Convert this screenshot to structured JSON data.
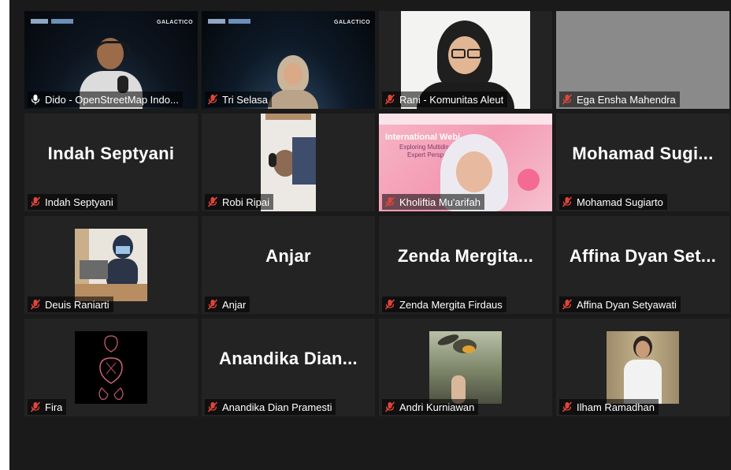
{
  "participants": [
    {
      "label": "Dido - OpenStreetMap Indo...",
      "display_name": "",
      "muted": false,
      "speaking": true
    },
    {
      "label": "Tri Selasa",
      "display_name": "",
      "muted": true
    },
    {
      "label": "Rani - Komunitas Aleut",
      "display_name": "",
      "muted": true
    },
    {
      "label": "Ega Ensha Mahendra",
      "display_name": "",
      "muted": true
    },
    {
      "label": "Indah Septyani",
      "display_name": "Indah Septyani",
      "muted": true
    },
    {
      "label": "Robi Ripai",
      "display_name": "",
      "muted": true
    },
    {
      "label": "Kholiftia Mu'arifah",
      "display_name": "",
      "muted": true
    },
    {
      "label": "Mohamad Sugiarto",
      "display_name": "Mohamad Sugi...",
      "muted": true
    },
    {
      "label": "Deuis Raniarti",
      "display_name": "",
      "muted": true
    },
    {
      "label": "Anjar",
      "display_name": "Anjar",
      "muted": true
    },
    {
      "label": "Zenda Mergita Firdaus",
      "display_name": "Zenda Mergita...",
      "muted": true
    },
    {
      "label": "Affina Dyan Setyawati",
      "display_name": "Affina Dyan Set...",
      "muted": true
    },
    {
      "label": "Fira",
      "display_name": "",
      "muted": true
    },
    {
      "label": "Anandika Dian Pramesti",
      "display_name": "Anandika Dian...",
      "muted": true
    },
    {
      "label": "Andri Kurniawan",
      "display_name": "",
      "muted": true
    },
    {
      "label": "Ilham Ramadhan",
      "display_name": "",
      "muted": true
    }
  ],
  "overlays": {
    "galactico": "GALACTICO",
    "webinar_title": "International Webi...",
    "webinar_sub1": "Exploring Multidisci...",
    "webinar_sub2": "Expert Perspe..."
  },
  "colors": {
    "active_border": "#c6e35c",
    "muted_icon": "#e0453b",
    "tile_bg": "#232323",
    "frame_bg": "#1a1a1a"
  },
  "icons": {
    "muted": "mic-muted-icon",
    "speaking": "mic-active-icon"
  }
}
